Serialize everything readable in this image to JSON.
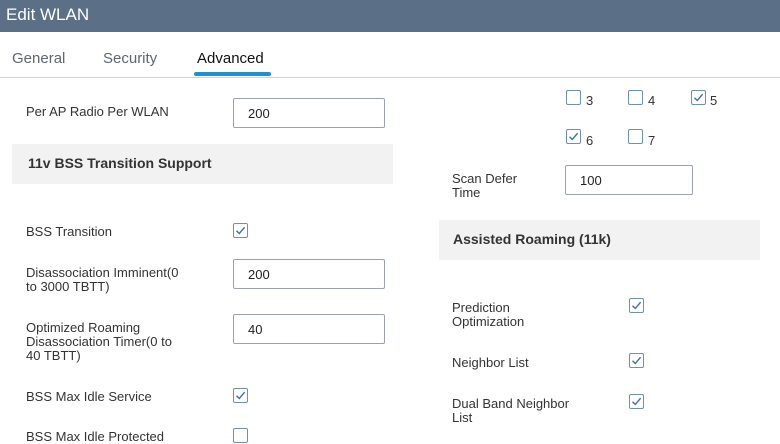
{
  "window": {
    "title": "Edit WLAN"
  },
  "tabs": [
    {
      "label": "General",
      "active": false
    },
    {
      "label": "Security",
      "active": false
    },
    {
      "label": "Advanced",
      "active": true
    }
  ],
  "left": {
    "per_ap_radio": {
      "label": "Per AP Radio Per WLAN",
      "value": "200"
    },
    "section_11v": "11v BSS Transition Support",
    "bss_transition": {
      "label": "BSS Transition",
      "checked": true
    },
    "disassoc_imminent": {
      "label_line1": "Disassociation Imminent(0",
      "label_line2": "to 3000 TBTT)",
      "value": "200"
    },
    "opt_roaming": {
      "label_line1": "Optimized Roaming",
      "label_line2": "Disassociation Timer(0 to",
      "label_line3": "40 TBTT)",
      "value": "40"
    },
    "bss_max_idle": {
      "label": "BSS Max Idle Service",
      "checked": true
    },
    "bss_max_idle_protected": {
      "label": "BSS Max Idle Protected",
      "checked": false
    }
  },
  "right": {
    "channels": [
      {
        "num": "3",
        "checked": false
      },
      {
        "num": "4",
        "checked": false
      },
      {
        "num": "5",
        "checked": true
      },
      {
        "num": "6",
        "checked": true
      },
      {
        "num": "7",
        "checked": false
      }
    ],
    "scan_defer_time": {
      "label_line1": "Scan Defer",
      "label_line2": "Time",
      "value": "100"
    },
    "section_assisted": "Assisted Roaming (11k)",
    "prediction_opt": {
      "label_line1": "Prediction",
      "label_line2": "Optimization",
      "checked": true
    },
    "neighbor_list": {
      "label": "Neighbor List",
      "checked": true
    },
    "dual_band": {
      "label_line1": "Dual Band Neighbor",
      "label_line2": "List",
      "checked": true
    }
  },
  "colors": {
    "titlebar": "#5b6f87",
    "accent": "#1f8fd1",
    "section_bg": "#f2f2f2"
  }
}
